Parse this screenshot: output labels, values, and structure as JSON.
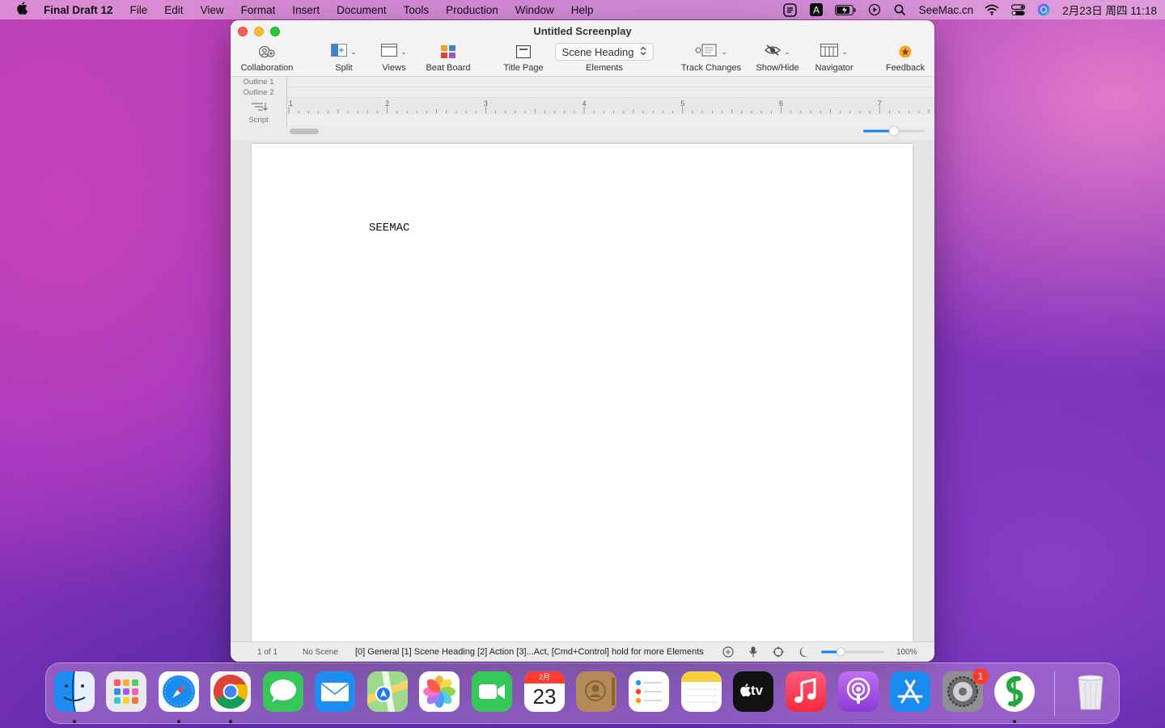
{
  "menubar": {
    "app_name": "Final Draft 12",
    "items": [
      "File",
      "Edit",
      "View",
      "Format",
      "Insert",
      "Document",
      "Tools",
      "Production",
      "Window",
      "Help"
    ],
    "site": "SeeMac.cn",
    "datetime": "2月23日 周四  11:18"
  },
  "window": {
    "title": "Untitled Screenplay",
    "toolbar": {
      "collaboration": "Collaboration",
      "split": "Split",
      "views": "Views",
      "beat_board": "Beat Board",
      "title_page": "Title Page",
      "element_value": "Scene Heading",
      "elements": "Elements",
      "track_changes": "Track Changes",
      "show_hide": "Show/Hide",
      "navigator": "Navigator",
      "feedback": "Feedback"
    },
    "outline": {
      "outline1": "Outline 1",
      "outline2": "Outline 2",
      "script": "Script"
    },
    "ruler_numbers": [
      "1",
      "2",
      "3",
      "4",
      "5",
      "6",
      "7"
    ],
    "zoom_slider_level": 0.5,
    "page_text": "SEEMAC",
    "status": {
      "page": "1 of 1",
      "scene": "No Scene",
      "message": "[0] General [1] Scene Heading [2] Action [3]...Act, [Cmd+Control] hold for more Elements",
      "zoom": "100%",
      "zoom_level": 0.3
    }
  },
  "dock": {
    "apps": [
      "Finder",
      "Launchpad",
      "Safari",
      "Chrome",
      "Messages",
      "Mail",
      "Maps",
      "Photos",
      "FaceTime",
      "Calendar",
      "Contacts",
      "Reminders",
      "Notes",
      "TV",
      "Music",
      "Podcasts",
      "App Store",
      "System Preferences",
      "Final Draft 12",
      "Trash"
    ],
    "calendar_month": "2月",
    "calendar_day": "23",
    "tv_label": "tv",
    "settings_badge": "1"
  },
  "colors": {
    "close": "#fe5f57",
    "minimize": "#febc2e",
    "maximize": "#28c840",
    "accent": "#1a7cf5"
  }
}
